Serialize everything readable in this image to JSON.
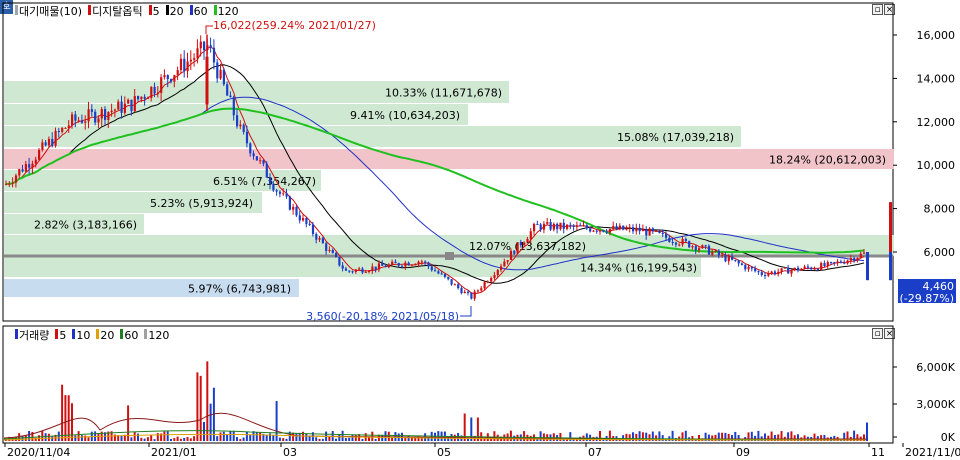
{
  "panel_top": {
    "legend": [
      {
        "label": "대기매물(10)",
        "color": "#9aa6b2"
      },
      {
        "label": "디지탈옵틱",
        "color": "#d01010"
      },
      {
        "label": "5",
        "color": "#d01010"
      },
      {
        "label": "20",
        "color": "#000000"
      },
      {
        "label": "60",
        "color": "#2030c8"
      },
      {
        "label": "120",
        "color": "#20c020"
      }
    ],
    "pin_label": "호",
    "yticks": [
      "16,000",
      "14,000",
      "12,000",
      "10,000",
      "8,000",
      "6,000"
    ],
    "volume_profile": [
      {
        "label": "10.33% (11,671,678)",
        "kind": "normal"
      },
      {
        "label": "9.41% (10,634,203)",
        "kind": "normal"
      },
      {
        "label": "15.08% (17,039,218)",
        "kind": "normal"
      },
      {
        "label": "18.24% (20,612,003)",
        "kind": "max"
      },
      {
        "label": "6.51% (7,354,267)",
        "kind": "normal"
      },
      {
        "label": "5.23% (5,913,924)",
        "kind": "normal"
      },
      {
        "label": "2.82% (3,183,166)",
        "kind": "normal"
      },
      {
        "label": "12.07% (13,637,182)",
        "kind": "normal"
      },
      {
        "label": "14.34% (16,199,543)",
        "kind": "normal"
      },
      {
        "label": "5.97% (6,743,981)",
        "kind": "current"
      }
    ],
    "high_annotation": "16,022(259.24% 2021/01/27)",
    "low_annotation": "3,560(-20.18% 2021/05/18)",
    "price_tag": "4,460",
    "change_tag": "(-29.87%)"
  },
  "panel_bottom": {
    "legend": [
      {
        "label": "거래량",
        "color": "#2030c8"
      },
      {
        "label": "5",
        "color": "#d01010"
      },
      {
        "label": "10",
        "color": "#2030c8"
      },
      {
        "label": "20",
        "color": "#e0a000"
      },
      {
        "label": "60",
        "color": "#208020"
      },
      {
        "label": "120",
        "color": "#a0a0a0"
      }
    ],
    "yticks": [
      "6,000K",
      "3,000K",
      "0K"
    ]
  },
  "xaxis": {
    "labels": [
      "2020/11/04",
      "2021/01",
      "03",
      "05",
      "07",
      "09",
      "11",
      "2021/11/08"
    ]
  },
  "window_buttons": {
    "maximize": "▫",
    "close": "×"
  },
  "colors": {
    "up": "#d01010",
    "down": "#1a3ec8",
    "ma5": "#d01010",
    "ma20": "#000000",
    "ma60": "#2030c8",
    "ma120": "#20c020",
    "profile_fill": "#cfe8d2",
    "profile_max": "#f0c4c8",
    "profile_current": "#c8dcef"
  },
  "chart_data": {
    "type": "candlestick",
    "title": "디지탈옵틱",
    "x_range": [
      "2020/11/04",
      "2021/11/08"
    ],
    "ylim": [
      5000,
      17000
    ],
    "price_high": {
      "value": 16022,
      "pct": 259.24,
      "date": "2021/01/27"
    },
    "price_low": {
      "value": 3560,
      "pct": -20.18,
      "date": "2021/05/18"
    },
    "last_price": 4460,
    "last_change_pct": -29.87,
    "close_series": [
      {
        "date": "2020/11",
        "close": 9100
      },
      {
        "date": "2020/12",
        "close": 12000
      },
      {
        "date": "2021/01",
        "close": 12800
      },
      {
        "date": "2021/01/27",
        "close": 15500
      },
      {
        "date": "2021/02",
        "close": 11500
      },
      {
        "date": "2021/03",
        "close": 8900
      },
      {
        "date": "2021/04",
        "close": 5100
      },
      {
        "date": "2021/05",
        "close": 5600
      },
      {
        "date": "2021/05/18",
        "close": 3900
      },
      {
        "date": "2021/06",
        "close": 7200
      },
      {
        "date": "2021/07",
        "close": 7000
      },
      {
        "date": "2021/08",
        "close": 6200
      },
      {
        "date": "2021/09",
        "close": 5000
      },
      {
        "date": "2021/10",
        "close": 5400
      },
      {
        "date": "2021/11",
        "close": 6000
      }
    ],
    "volume_ylim": [
      0,
      8000
    ]
  }
}
